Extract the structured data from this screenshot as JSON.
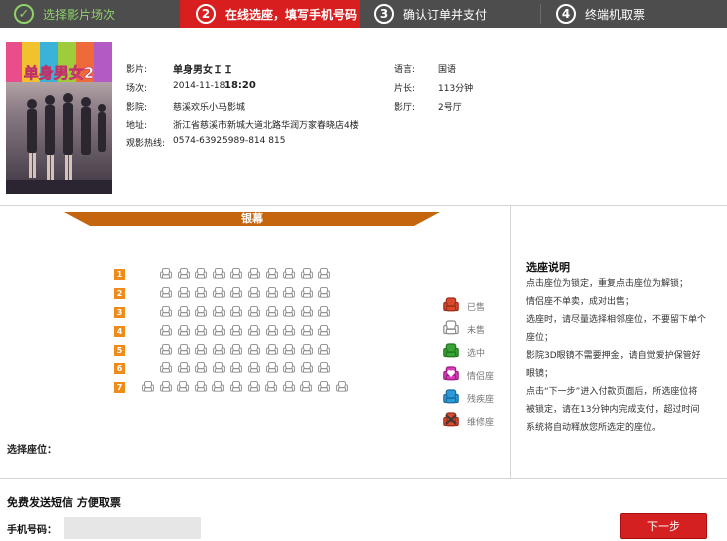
{
  "steps": [
    {
      "number": "✓",
      "label": "选择影片场次",
      "state": "done"
    },
    {
      "number": "2",
      "label": "在线选座，填写手机号码",
      "state": "current"
    },
    {
      "number": "3",
      "label": "确认订单并支付",
      "state": "todo"
    },
    {
      "number": "4",
      "label": "终端机取票",
      "state": "todo"
    }
  ],
  "movie": {
    "poster_title": "单身男女2",
    "film_label": "影片:",
    "film": "单身男女ＩＩ",
    "showtime_label": "场次:",
    "date": "2014-11-18",
    "time": "18:20",
    "cinema_label": "影院:",
    "cinema": "慈溪欢乐小马影城",
    "address_label": "地址:",
    "address": "浙江省慈溪市新城大道北路华润万家春晓店4楼",
    "hotline_label": "观影热线:",
    "hotline": "0574-63925989-814 815",
    "language_label": "语言:",
    "language": "国语",
    "duration_label": "片长:",
    "duration": "113分钟",
    "hall_label": "影厅:",
    "hall": "2号厅"
  },
  "screen_label": "银幕",
  "seat_map": {
    "rows": [
      "1",
      "2",
      "3",
      "4",
      "5",
      "6",
      "7"
    ],
    "seat_counts": [
      10,
      10,
      10,
      10,
      10,
      10,
      12
    ],
    "seat_status": "available"
  },
  "legend": [
    {
      "label": "已售",
      "icon": "sold-seat-icon",
      "color": "#d84a2e"
    },
    {
      "label": "未售",
      "icon": "available-seat-icon",
      "color": "#ffffff"
    },
    {
      "label": "选中",
      "icon": "selected-seat-icon",
      "color": "#3aa336"
    },
    {
      "label": "情侣座",
      "icon": "couple-seat-icon",
      "color": "#d93ab8"
    },
    {
      "label": "残疾座",
      "icon": "disabled-seat-icon",
      "color": "#2d9ad8"
    },
    {
      "label": "维修座",
      "icon": "maintenance-seat-icon",
      "color": "#d84a2e"
    }
  ],
  "chosen_label": "选择座位：",
  "help": {
    "title": "选座说明",
    "lines": [
      "点击座位为锁定，重复点击座位为解锁；",
      "情侣座不单卖，成对出售；",
      "选座时，请尽量选择相邻座位，不要留下单个座位；",
      "影院3D眼镜不需要押金，请自觉爱护保管好眼镜；",
      "点击“下一步”进入付款页面后，所选座位将被锁定，请在13分钟内完成支付，超过时间系统将自动释放您所选定的座位。"
    ]
  },
  "sms": {
    "title": "免费发送短信 方便取票",
    "phone_label": "手机号码：",
    "phone_value": "",
    "next_label": "下一步"
  }
}
